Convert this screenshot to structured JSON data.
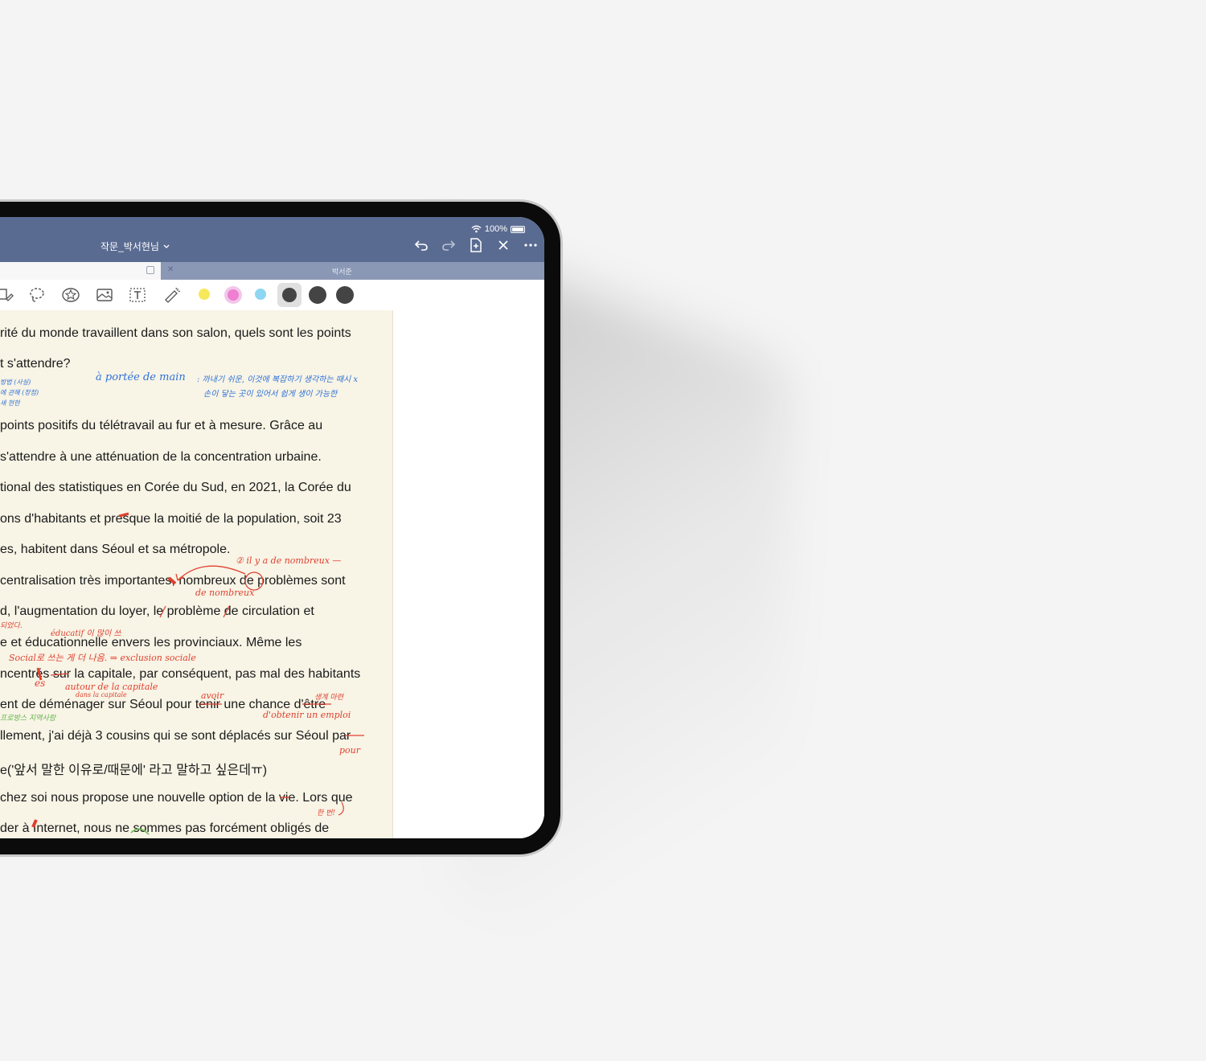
{
  "status": {
    "battery": "100%"
  },
  "header": {
    "doc_title": "작문_박서현님"
  },
  "tabs": {
    "secondary_label": "박서준"
  },
  "toolbar": {
    "colors": [
      "#f7e85a",
      "#ef7fd0",
      "#8fd6f2",
      "#444444",
      "#444444",
      "#444444"
    ],
    "selected_color_index": 3
  },
  "document": {
    "lines": [
      "rité du monde travaillent dans son salon, quels sont les points",
      "t s'attendre?",
      "points positifs du télétravail au fur et à mesure. Grâce au",
      "s'attendre à une atténuation de la concentration urbaine.",
      "tional des statistiques en Corée du Sud, en 2021, la Corée du",
      "ons d'habitants et presque la moitié de la population, soit 23",
      "es, habitent dans Séoul et sa métropole.",
      "centralisation très importantes, nombreux de problèmes sont",
      "d, l'augmentation du loyer, le problème de circulation et",
      "e et éducationnelle envers les provinciaux. Même les",
      "ncentrés sur la capitale, par conséquent, pas mal des habitants",
      "ent de déménager sur Séoul pour tenir une chance d'être",
      "llement, j'ai déjà 3 cousins qui se sont déplacés sur Séoul par",
      "e('앞서 말한 이유로/때문에' 라고 말하고 싶은데ㅠ)",
      " chez soi nous propose une nouvelle option de la vie. Lors que",
      "der à Internet, nous ne sommes pas forcément obligés de"
    ],
    "annotations": {
      "blue_phrase": "à portée de main",
      "blue_note_1": ": 까내기 쉬운, 이것에 복잡하기 생각하는 때시 x",
      "blue_note_2": "손이 닿는 곳이 있어서 쉽게 생이 가능한",
      "blue_left_1": "방법 (사실)",
      "blue_left_2": "에 관해 (장점)",
      "blue_left_3": "새 현현",
      "red_ilya": "② il y a de nombreux —",
      "red_denombreux": "de nombreux",
      "red_dit": "되었다.",
      "red_educatif": "éducatif 이 많이 쓰",
      "red_social": "Social로 쓰는 게 더 나음. ⇒ exclusion sociale",
      "red_es": "es",
      "red_autour": "autour de la capitale",
      "red_dans": "dans la capitale",
      "red_avoir": "avoir",
      "red_obtenir": "d'obtenir un emploi",
      "red_emploi_kr": "생계 마련",
      "red_pour": "pour",
      "red_rmk": "한 번!",
      "green_note": "프로방스 지역사람"
    }
  }
}
